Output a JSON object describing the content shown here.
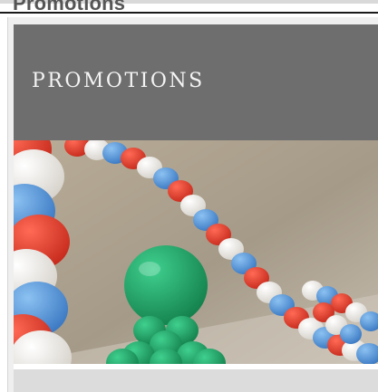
{
  "section": {
    "heading": "Promotions"
  },
  "promo_card": {
    "banner_title": "PROMOTIONS",
    "image_icon": "balloon-arch-photo",
    "colors": {
      "banner": "#6e6e6e",
      "balloon_red": "#e8392b",
      "balloon_white": "#f4f2ee",
      "balloon_blue": "#4a90d9",
      "balloon_green": "#1f9e62"
    }
  }
}
